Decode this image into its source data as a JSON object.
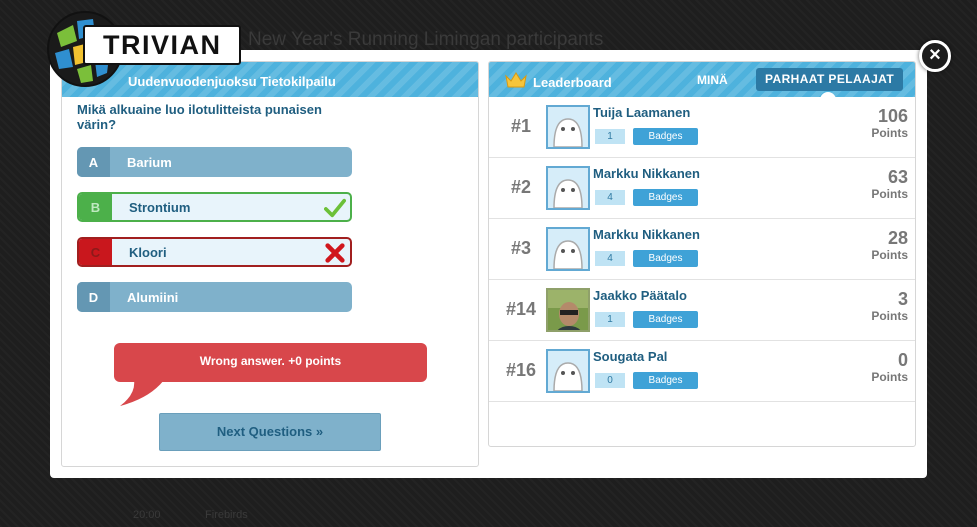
{
  "page": {
    "background_title": "New Year's Running Limingan participants",
    "footer_left": "20:00",
    "footer_right": "Firebirds"
  },
  "logo": {
    "text": "TRIVIAN"
  },
  "quiz": {
    "header": "Uudenvuodenjuoksu Tietokilpailu",
    "question": "Mikä alkuaine luo ilotulitteista punaisen värin?",
    "answers": [
      {
        "letter": "A",
        "text": "Barium",
        "state": "plain"
      },
      {
        "letter": "B",
        "text": "Strontium",
        "state": "correct"
      },
      {
        "letter": "C",
        "text": "Kloori",
        "state": "wrong"
      },
      {
        "letter": "D",
        "text": "Alumiini",
        "state": "plain"
      }
    ],
    "feedback": "Wrong answer. +0 points",
    "next_button": "Next Questions »"
  },
  "leaderboard": {
    "title": "Leaderboard",
    "tab_me": "MINÄ",
    "tab_best": "PARHAAT PELAAJAT",
    "rows": [
      {
        "rank": "#1",
        "name": "Tuija Laamanen",
        "count": "1",
        "badges_label": "Badges",
        "points": "106",
        "points_label": "Points",
        "avatar": "default"
      },
      {
        "rank": "#2",
        "name": "Markku Nikkanen",
        "count": "4",
        "badges_label": "Badges",
        "points": "63",
        "points_label": "Points",
        "avatar": "default"
      },
      {
        "rank": "#3",
        "name": "Markku Nikkanen",
        "count": "4",
        "badges_label": "Badges",
        "points": "28",
        "points_label": "Points",
        "avatar": "default"
      },
      {
        "rank": "#14",
        "name": "Jaakko Päätalo",
        "count": "1",
        "badges_label": "Badges",
        "points": "3",
        "points_label": "Points",
        "avatar": "photo"
      },
      {
        "rank": "#16",
        "name": "Sougata Pal",
        "count": "0",
        "badges_label": "Badges",
        "points": "0",
        "points_label": "Points",
        "avatar": "default"
      }
    ]
  },
  "colors": {
    "header_blue": "#4eb2dd",
    "text_blue": "#1f5e80",
    "correct_green": "#4cb04a",
    "wrong_red": "#c9171d",
    "feedback_red": "#d8474b"
  }
}
